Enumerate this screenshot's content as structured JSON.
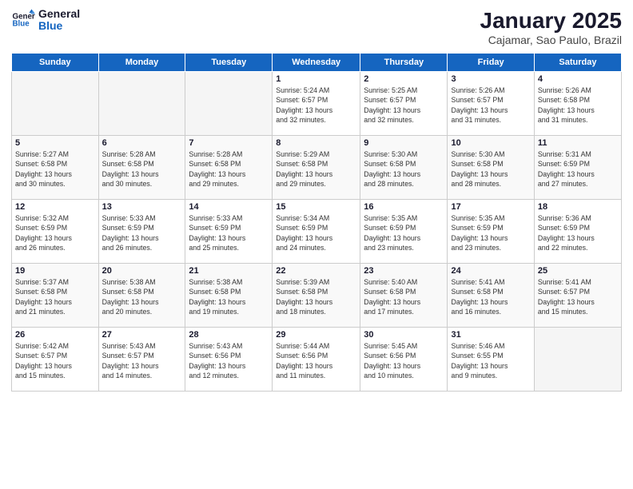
{
  "header": {
    "logo_line1": "General",
    "logo_line2": "Blue",
    "month_title": "January 2025",
    "subtitle": "Cajamar, Sao Paulo, Brazil"
  },
  "days_of_week": [
    "Sunday",
    "Monday",
    "Tuesday",
    "Wednesday",
    "Thursday",
    "Friday",
    "Saturday"
  ],
  "weeks": [
    [
      {
        "day": "",
        "info": ""
      },
      {
        "day": "",
        "info": ""
      },
      {
        "day": "",
        "info": ""
      },
      {
        "day": "1",
        "info": "Sunrise: 5:24 AM\nSunset: 6:57 PM\nDaylight: 13 hours\nand 32 minutes."
      },
      {
        "day": "2",
        "info": "Sunrise: 5:25 AM\nSunset: 6:57 PM\nDaylight: 13 hours\nand 32 minutes."
      },
      {
        "day": "3",
        "info": "Sunrise: 5:26 AM\nSunset: 6:57 PM\nDaylight: 13 hours\nand 31 minutes."
      },
      {
        "day": "4",
        "info": "Sunrise: 5:26 AM\nSunset: 6:58 PM\nDaylight: 13 hours\nand 31 minutes."
      }
    ],
    [
      {
        "day": "5",
        "info": "Sunrise: 5:27 AM\nSunset: 6:58 PM\nDaylight: 13 hours\nand 30 minutes."
      },
      {
        "day": "6",
        "info": "Sunrise: 5:28 AM\nSunset: 6:58 PM\nDaylight: 13 hours\nand 30 minutes."
      },
      {
        "day": "7",
        "info": "Sunrise: 5:28 AM\nSunset: 6:58 PM\nDaylight: 13 hours\nand 29 minutes."
      },
      {
        "day": "8",
        "info": "Sunrise: 5:29 AM\nSunset: 6:58 PM\nDaylight: 13 hours\nand 29 minutes."
      },
      {
        "day": "9",
        "info": "Sunrise: 5:30 AM\nSunset: 6:58 PM\nDaylight: 13 hours\nand 28 minutes."
      },
      {
        "day": "10",
        "info": "Sunrise: 5:30 AM\nSunset: 6:58 PM\nDaylight: 13 hours\nand 28 minutes."
      },
      {
        "day": "11",
        "info": "Sunrise: 5:31 AM\nSunset: 6:59 PM\nDaylight: 13 hours\nand 27 minutes."
      }
    ],
    [
      {
        "day": "12",
        "info": "Sunrise: 5:32 AM\nSunset: 6:59 PM\nDaylight: 13 hours\nand 26 minutes."
      },
      {
        "day": "13",
        "info": "Sunrise: 5:33 AM\nSunset: 6:59 PM\nDaylight: 13 hours\nand 26 minutes."
      },
      {
        "day": "14",
        "info": "Sunrise: 5:33 AM\nSunset: 6:59 PM\nDaylight: 13 hours\nand 25 minutes."
      },
      {
        "day": "15",
        "info": "Sunrise: 5:34 AM\nSunset: 6:59 PM\nDaylight: 13 hours\nand 24 minutes."
      },
      {
        "day": "16",
        "info": "Sunrise: 5:35 AM\nSunset: 6:59 PM\nDaylight: 13 hours\nand 23 minutes."
      },
      {
        "day": "17",
        "info": "Sunrise: 5:35 AM\nSunset: 6:59 PM\nDaylight: 13 hours\nand 23 minutes."
      },
      {
        "day": "18",
        "info": "Sunrise: 5:36 AM\nSunset: 6:59 PM\nDaylight: 13 hours\nand 22 minutes."
      }
    ],
    [
      {
        "day": "19",
        "info": "Sunrise: 5:37 AM\nSunset: 6:58 PM\nDaylight: 13 hours\nand 21 minutes."
      },
      {
        "day": "20",
        "info": "Sunrise: 5:38 AM\nSunset: 6:58 PM\nDaylight: 13 hours\nand 20 minutes."
      },
      {
        "day": "21",
        "info": "Sunrise: 5:38 AM\nSunset: 6:58 PM\nDaylight: 13 hours\nand 19 minutes."
      },
      {
        "day": "22",
        "info": "Sunrise: 5:39 AM\nSunset: 6:58 PM\nDaylight: 13 hours\nand 18 minutes."
      },
      {
        "day": "23",
        "info": "Sunrise: 5:40 AM\nSunset: 6:58 PM\nDaylight: 13 hours\nand 17 minutes."
      },
      {
        "day": "24",
        "info": "Sunrise: 5:41 AM\nSunset: 6:58 PM\nDaylight: 13 hours\nand 16 minutes."
      },
      {
        "day": "25",
        "info": "Sunrise: 5:41 AM\nSunset: 6:57 PM\nDaylight: 13 hours\nand 15 minutes."
      }
    ],
    [
      {
        "day": "26",
        "info": "Sunrise: 5:42 AM\nSunset: 6:57 PM\nDaylight: 13 hours\nand 15 minutes."
      },
      {
        "day": "27",
        "info": "Sunrise: 5:43 AM\nSunset: 6:57 PM\nDaylight: 13 hours\nand 14 minutes."
      },
      {
        "day": "28",
        "info": "Sunrise: 5:43 AM\nSunset: 6:56 PM\nDaylight: 13 hours\nand 12 minutes."
      },
      {
        "day": "29",
        "info": "Sunrise: 5:44 AM\nSunset: 6:56 PM\nDaylight: 13 hours\nand 11 minutes."
      },
      {
        "day": "30",
        "info": "Sunrise: 5:45 AM\nSunset: 6:56 PM\nDaylight: 13 hours\nand 10 minutes."
      },
      {
        "day": "31",
        "info": "Sunrise: 5:46 AM\nSunset: 6:55 PM\nDaylight: 13 hours\nand 9 minutes."
      },
      {
        "day": "",
        "info": ""
      }
    ]
  ]
}
